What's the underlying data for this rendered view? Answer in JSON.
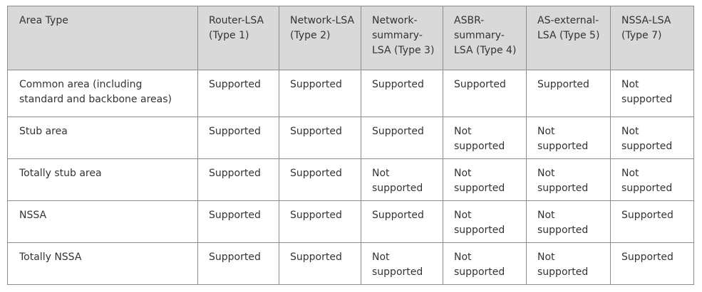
{
  "table": {
    "headers": [
      "Area Type",
      "Router-LSA (Type 1)",
      "Network-LSA (Type 2)",
      "Network-summary-LSA (Type 3)",
      "ASBR-summary-LSA (Type 4)",
      "AS-external-LSA (Type 5)",
      "NSSA-LSA (Type 7)"
    ],
    "rows": [
      [
        "Common area (including standard and backbone areas)",
        "Supported",
        "Supported",
        "Supported",
        "Supported",
        "Supported",
        "Not supported"
      ],
      [
        "Stub area",
        "Supported",
        "Supported",
        "Supported",
        "Not supported",
        "Not supported",
        "Not supported"
      ],
      [
        "Totally stub area",
        "Supported",
        "Supported",
        "Not supported",
        "Not supported",
        "Not supported",
        "Not supported"
      ],
      [
        "NSSA",
        "Supported",
        "Supported",
        "Supported",
        "Not supported",
        "Not supported",
        "Supported"
      ],
      [
        "Totally NSSA",
        "Supported",
        "Supported",
        "Not supported",
        "Not supported",
        "Not supported",
        "Supported"
      ]
    ]
  }
}
